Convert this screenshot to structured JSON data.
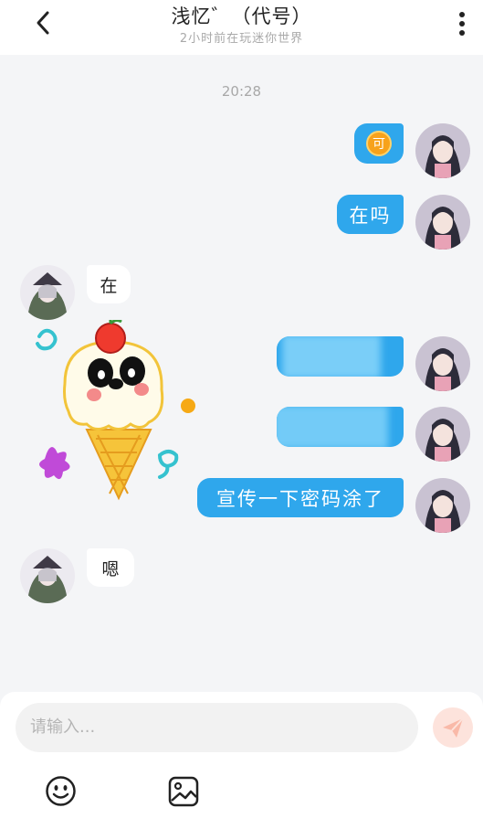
{
  "header": {
    "title": "浅忆゛（代号）",
    "subtitle": "2小时前在玩迷你世界"
  },
  "chat": {
    "timestamp": "20:28",
    "messages": [
      {
        "side": "right",
        "text": "可"
      },
      {
        "side": "right",
        "text": "在吗"
      },
      {
        "side": "left",
        "text": "在"
      },
      {
        "side": "left",
        "type": "sticker",
        "text": ""
      },
      {
        "side": "right",
        "type": "redacted",
        "text": ""
      },
      {
        "side": "right",
        "type": "redacted",
        "text": ""
      },
      {
        "side": "right",
        "text": "宣传一下密码涂了"
      },
      {
        "side": "left",
        "text": "嗯"
      }
    ]
  },
  "composer": {
    "placeholder": "请输入..."
  },
  "icons": {
    "back": "chevron-left-icon",
    "more": "more-vertical-icon",
    "send": "send-icon",
    "emoji": "emoji-icon",
    "image": "image-icon"
  },
  "colors": {
    "accent": "#2fa7ec",
    "background": "#f4f5f7",
    "send_disabled": "#fde3dc"
  }
}
